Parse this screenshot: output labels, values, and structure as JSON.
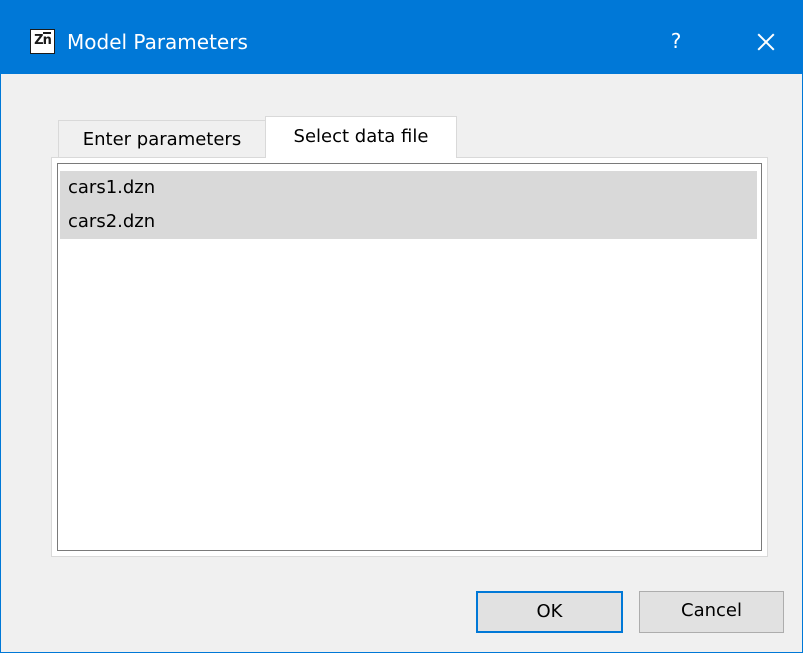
{
  "window": {
    "title": "Model Parameters",
    "icon": "zn-app-icon",
    "icon_text": "Zn",
    "help_label": "?",
    "accent_color": "#0078d7"
  },
  "tabs": [
    {
      "label": "Enter parameters",
      "selected": false
    },
    {
      "label": "Select data file",
      "selected": true
    }
  ],
  "data_files": [
    {
      "name": "cars1.dzn",
      "selected": true
    },
    {
      "name": "cars2.dzn",
      "selected": true
    }
  ],
  "buttons": {
    "ok_label": "OK",
    "cancel_label": "Cancel"
  }
}
